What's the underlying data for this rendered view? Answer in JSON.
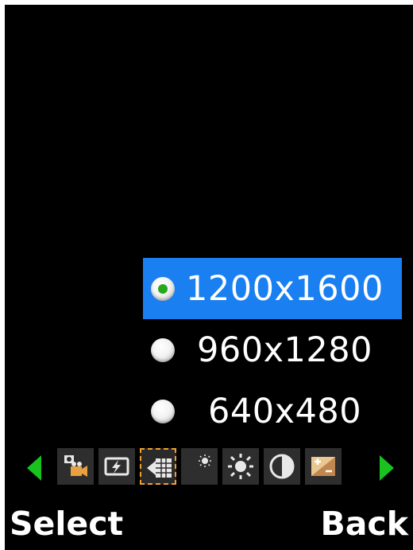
{
  "resolution_menu": {
    "options": [
      {
        "label": "1200x1600",
        "selected": true
      },
      {
        "label": "960x1280",
        "selected": false
      },
      {
        "label": "640x480",
        "selected": false
      }
    ]
  },
  "toolbar": {
    "icons": [
      "video-camera-icon",
      "flash-icon",
      "resolution-icon",
      "night-mode-icon",
      "brightness-icon",
      "contrast-icon",
      "exposure-icon"
    ],
    "active_icon": "resolution-icon",
    "arrow_color": "#19c21f",
    "highlight_color": "#f0a030"
  },
  "softkeys": {
    "left": "Select",
    "right": "Back"
  },
  "colors": {
    "selection": "#1a7ff0",
    "radio_dot": "#27a81c",
    "background": "#000000"
  }
}
